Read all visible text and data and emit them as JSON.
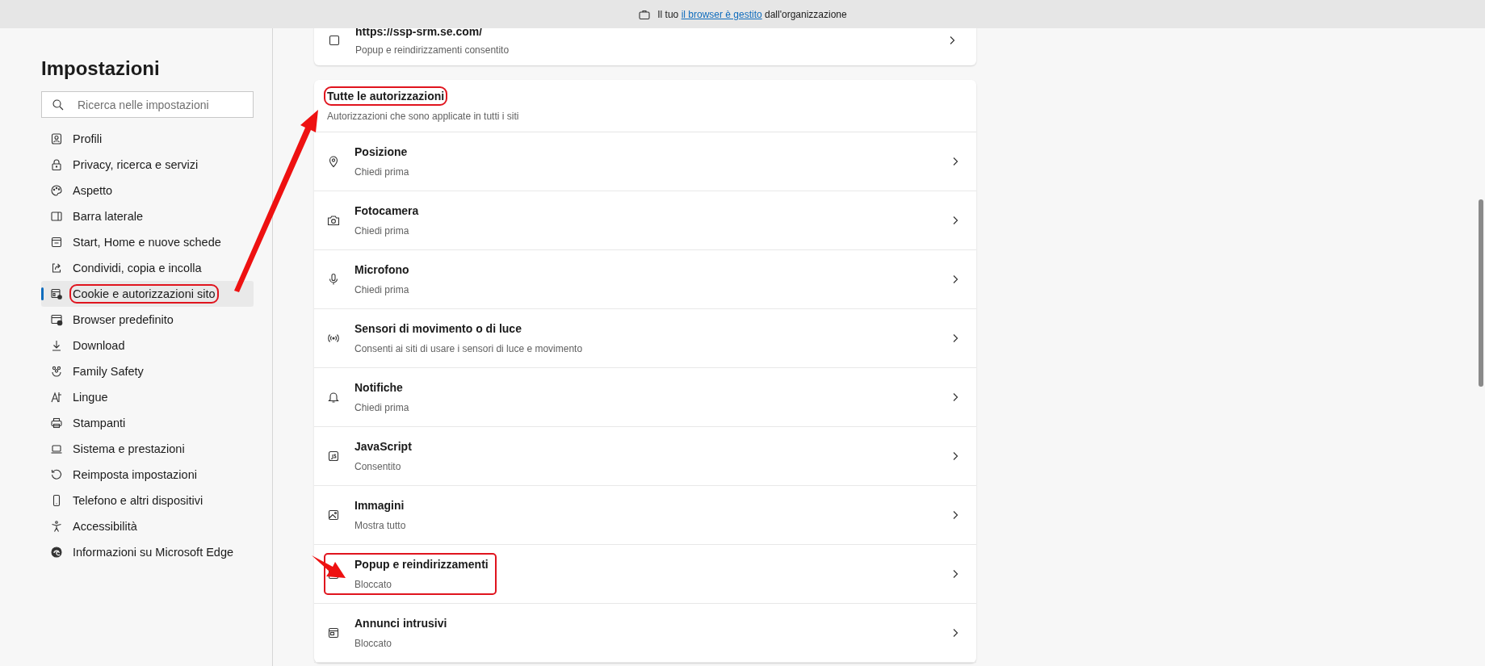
{
  "top_bar": {
    "text_before": "Il tuo",
    "link": "il browser è gestito",
    "text_after": "dall'organizzazione"
  },
  "sidebar": {
    "title": "Impostazioni",
    "search": {
      "placeholder": "Ricerca nelle impostazioni"
    },
    "items": [
      {
        "label": "Profili",
        "selected": false,
        "highlighted": false
      },
      {
        "label": "Privacy, ricerca e servizi",
        "selected": false,
        "highlighted": false
      },
      {
        "label": "Aspetto",
        "selected": false,
        "highlighted": false
      },
      {
        "label": "Barra laterale",
        "selected": false,
        "highlighted": false
      },
      {
        "label": "Start, Home e nuove schede",
        "selected": false,
        "highlighted": false
      },
      {
        "label": "Condividi, copia e incolla",
        "selected": false,
        "highlighted": false
      },
      {
        "label": "Cookie e autorizzazioni sito",
        "selected": true,
        "highlighted": true
      },
      {
        "label": "Browser predefinito",
        "selected": false,
        "highlighted": false
      },
      {
        "label": "Download",
        "selected": false,
        "highlighted": false
      },
      {
        "label": "Family Safety",
        "selected": false,
        "highlighted": false
      },
      {
        "label": "Lingue",
        "selected": false,
        "highlighted": false
      },
      {
        "label": "Stampanti",
        "selected": false,
        "highlighted": false
      },
      {
        "label": "Sistema e prestazioni",
        "selected": false,
        "highlighted": false
      },
      {
        "label": "Reimposta impostazioni",
        "selected": false,
        "highlighted": false
      },
      {
        "label": "Telefono e altri dispositivi",
        "selected": false,
        "highlighted": false
      },
      {
        "label": "Accessibilità",
        "selected": false,
        "highlighted": false
      },
      {
        "label": "Informazioni su Microsoft Edge",
        "selected": false,
        "highlighted": false
      }
    ]
  },
  "site_card": {
    "url": "https://ssp-srm.se.com/",
    "status": "Popup e reindirizzamenti consentito"
  },
  "permissions": {
    "title": "Tutte le autorizzazioni",
    "title_highlighted": true,
    "subtitle": "Autorizzazioni che sono applicate in tutti i siti",
    "rows": [
      {
        "title": "Posizione",
        "value": "Chiedi prima",
        "highlighted": false
      },
      {
        "title": "Fotocamera",
        "value": "Chiedi prima",
        "highlighted": false
      },
      {
        "title": "Microfono",
        "value": "Chiedi prima",
        "highlighted": false
      },
      {
        "title": "Sensori di movimento o di luce",
        "value": "Consenti ai siti di usare i sensori di luce e movimento",
        "highlighted": false
      },
      {
        "title": "Notifiche",
        "value": "Chiedi prima",
        "highlighted": false
      },
      {
        "title": "JavaScript",
        "value": "Consentito",
        "highlighted": false
      },
      {
        "title": "Immagini",
        "value": "Mostra tutto",
        "highlighted": false
      },
      {
        "title": "Popup e reindirizzamenti",
        "value": "Bloccato",
        "highlighted": true
      },
      {
        "title": "Annunci intrusivi",
        "value": "Bloccato",
        "highlighted": false
      }
    ]
  }
}
